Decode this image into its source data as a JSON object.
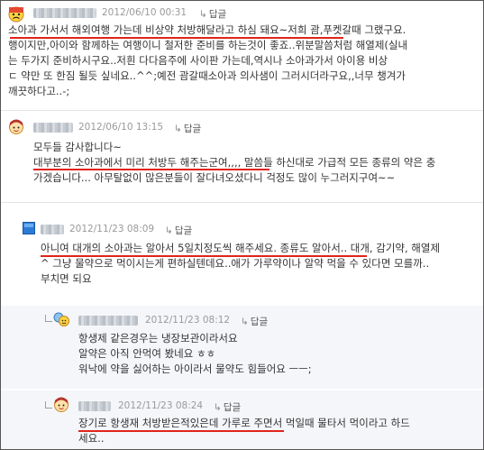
{
  "reply_label": "답글",
  "comments": [
    {
      "date": "2012/06/10 00:31",
      "lines": [
        "소아과 가서서 해외여행 가는데 비상약 처방해달라고 하심 돼요~저희 괌,푸켓갈때 그랬구요.",
        "행이지만,아이와 함께하는 여행이니 철저한 준비를 하는것이 좋죠..위분말씀처럼 해열제(실내",
        "는 두가지 준비하시구요..저흰 다다음주에 사이판 가는데,역시나 소아과가서 아이용 비상",
        "ㄷ 약만 또 한짐 될듯 싶네요..^^;예전 괌갈때소아과 의사샘이 그러시더라구요,,너무 챙겨가",
        "깨끗하다고..-;"
      ]
    },
    {
      "date": "2012/06/10 13:15",
      "lines": [
        "모두들 감사합니다~",
        "대부분의 소아과에서 미리 처방두 해주는군여,,,, 말씀들 하신대로 가급적 모든 종류의 약은 충",
        "가겠습니다... 아무탈없이 많은분들이 잘다녀오셨다니 걱정도 많이 누그러지구여~~"
      ]
    },
    {
      "date": "2012/11/23 08:09",
      "lines": [
        "아니여 대개의 소아과는 알아서 5일치정도씩 해주세요. 종류도 알아서.. 대개, 감기약, 해열제",
        "^ 그냥 물약으로 먹이시는게 편하실텐데요..애가 가루약이나 알약 먹을 수 있다면 모를까..",
        "부치면 되요"
      ]
    },
    {
      "date": "2012/11/23 08:12",
      "lines": [
        "항생제 같은경우는 냉장보관이라서요",
        "알약은 아직 안먹여 봤네요 ㅎㅎ",
        "워낙에 약을 싫어하는 아이라서 물약도 힘들어요 ㅡㅡ;"
      ]
    },
    {
      "date": "2012/11/23 08:24",
      "lines": [
        "장기로 항생재 처방받은적있은데 가루로 주면서 먹일때 물타서 먹이라고 하드",
        "세요.."
      ]
    }
  ]
}
